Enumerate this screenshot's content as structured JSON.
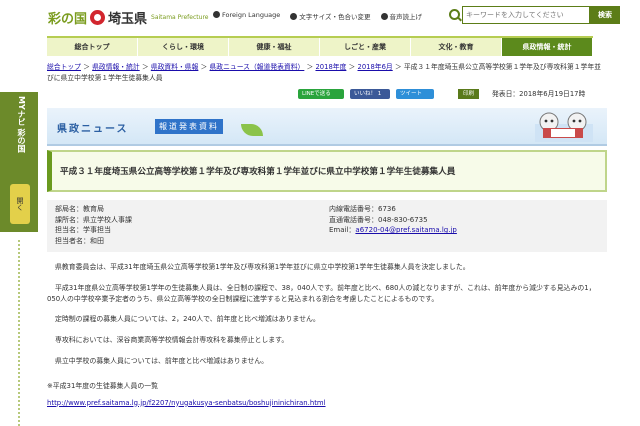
{
  "side": {
    "label": "MYナビ 彩の国",
    "open_label": "開く"
  },
  "header": {
    "logo_kuni": "彩の国",
    "logo_ken": "埼玉県",
    "logo_en": "Saitama Prefecture",
    "links": [
      "Foreign Language",
      "文字サイズ・色合い変更",
      "音声読上げ"
    ],
    "search_placeholder": "キーワードを入力してください",
    "search_button": "検索"
  },
  "nav": [
    "総合トップ",
    "くらし・環境",
    "健康・福祉",
    "しごと・産業",
    "文化・教育",
    "県政情報・統計"
  ],
  "breadcrumb": [
    "総合トップ",
    "県政情報・統計",
    "県政資料・県報",
    "県政ニュース（報道発表資料）",
    "2018年度",
    "2018年6月"
  ],
  "breadcrumb_current": "平成３１年度埼玉県公立高等学校第１学年及び専攻科第１学年並びに県立中学校第１学年生徒募集人員",
  "share": {
    "line": "LINEで送る",
    "like": "いいね！ 1",
    "tweet": "ツイート"
  },
  "print_label": "印刷",
  "published": "発表日：2018年6月19日17時",
  "banner": {
    "title": "県政ニュース",
    "subtitle": "報道発表資料"
  },
  "title": "平成３１年度埼玉県公立高等学校第１学年及び専攻科第１学年並びに県立中学校第１学年生徒募集人員",
  "info": {
    "dept": "部局名：教育局",
    "section": "課所名：県立学校人事課",
    "charge": "担当名：学事担当",
    "person": "担当者名：和田",
    "ext": "内線電話番号：6736",
    "direct": "直通電話番号：048-830-6735",
    "email_label": "Email：",
    "email": "a6720-04@pref.saitama.lg.jp"
  },
  "body": {
    "p1": "県教育委員会は、平成31年度埼玉県公立高等学校第1学年及び専攻科第1学年並びに県立中学校第1学年生徒募集人員を決定しました。",
    "p2": "平成31年度県公立高等学校第1学年の生徒募集人員は、全日制の課程で、38，040人です。前年度と比べ、680人の減となりますが、これは、前年度から減少する見込みの1，050人の中学校卒業予定者のうち、県公立高等学校の全日制課程に進学すると見込まれる割合を考慮したことによるものです。",
    "p3": "定時制の課程の募集人員については、2，240人で、前年度と比べ増減はありません。",
    "p4": "専攻科においては、深谷商業高等学校情報会計専攻科を募集停止とします。",
    "p5": "県立中学校の募集人員については、前年度と比べ増減はありません。",
    "p6": "※平成31年度の生徒募集人員の一覧",
    "link": "http://www.pref.saitama.lg.jp/f2207/nyugakusya-senbatsu/boshujininichiran.html"
  }
}
